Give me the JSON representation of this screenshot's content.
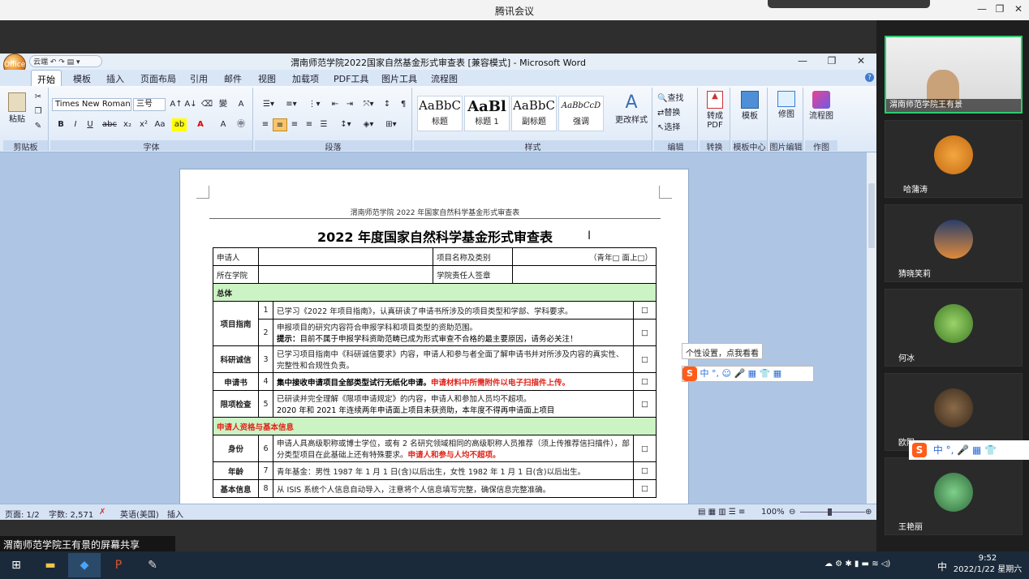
{
  "meeting": {
    "title": "腾讯会议",
    "share_label": "渭南师范学院王有景的屏幕共享",
    "participants": [
      {
        "name": "渭南师范学院王有景",
        "active": true
      },
      {
        "name": "哈蒲涛"
      },
      {
        "name": "猜晓笑莉"
      },
      {
        "name": "何冰"
      },
      {
        "name": "欧阳"
      },
      {
        "name": "王艳丽"
      }
    ]
  },
  "word": {
    "window_title": "渭南师范学院2022国家自然基金形式审查表 [兼容模式] - Microsoft Word",
    "office_button": "Office",
    "qat_label": "云端",
    "tabs": [
      "开始",
      "模板",
      "插入",
      "页面布局",
      "引用",
      "邮件",
      "视图",
      "加载项",
      "PDF工具",
      "图片工具",
      "流程图"
    ],
    "ribbon": {
      "clipboard": {
        "label": "剪贴板",
        "paste": "粘贴"
      },
      "font": {
        "label": "字体",
        "name": "Times New Roman",
        "size": "三号"
      },
      "paragraph": {
        "label": "段落"
      },
      "styles": {
        "label": "样式",
        "items": [
          {
            "sample": "AaBbC",
            "name": "标题"
          },
          {
            "sample": "AaBl",
            "name": "标题 1"
          },
          {
            "sample": "AaBbC",
            "name": "副标题"
          },
          {
            "sample": "AaBbCcD",
            "name": "强调"
          }
        ],
        "change": "更改样式"
      },
      "editing": {
        "label": "编辑",
        "find": "查找",
        "replace": "替换",
        "select": "选择"
      },
      "convert": {
        "label": "转换",
        "btn": "转成 PDF"
      },
      "template": {
        "label": "模板中心",
        "btn": "模板"
      },
      "image": {
        "label": "图片编辑",
        "btn": "修图"
      },
      "works": {
        "label": "作图",
        "btn": "流程图"
      }
    },
    "status": {
      "page": "页面: 1/2",
      "words": "字数: 2,571",
      "lang": "英语(美国)",
      "mode": "插入",
      "zoom": "100%"
    }
  },
  "doc": {
    "header": "渭南师范学院 2022 年国家自然科学基金形式审查表",
    "title": "2022 年度国家自然科学基金形式审查表",
    "applicant_label": "申请人",
    "project_label": "项目名称及类别",
    "project_hint": "（青年□  面上□）",
    "college_label": "所在学院",
    "leader_label": "学院责任人签章",
    "sec_general": "总体",
    "sec_qual": "申请人资格与基本信息",
    "rows": [
      {
        "label": "项目指南",
        "num": "1",
        "text": "已学习《2022 年项目指南》，认真研读了申请书所涉及的项目类型和学部、学科要求。"
      },
      {
        "label": "",
        "num": "2",
        "text": "申报项目的研究内容符合申报学科和项目类型的资助范围。",
        "hint_bold": "提示：",
        "hint": "目前不属于申报学科资助范畴已成为形式审查不合格的最主要原因，请务必关注！"
      },
      {
        "label": "科研诚信",
        "num": "3",
        "text": "已学习项目指南中《科研诚信要求》内容，申请人和参与者全面了解申请书并对所涉及内容的真实性、完整性和合规性负责。"
      },
      {
        "label": "申请书",
        "num": "4",
        "text": "集中接收申请项目全部类型试行无纸化申请。",
        "red": "申请材料中所需附件以电子扫描件上传。"
      },
      {
        "label": "限项检查",
        "num": "5",
        "text": "已研读并完全理解《限项申请规定》的内容，申请人和参加人员均不超项。",
        "text2": "2020 年和 2021 年连续两年申请面上项目未获资助，本年度不得再申请面上项目"
      },
      {
        "label": "身份",
        "num": "6",
        "text": "申请人具高级职称或博士学位，或有 2 名研究领域相同的高级职称人员推荐（须上传推荐信扫描件），部分类型项目在此基础上还有特殊要求。",
        "red": "申请人和参与人均不超项。"
      },
      {
        "label": "年龄",
        "num": "7",
        "text": "青年基金：男性 1987 年 1 月 1 日(含)以后出生，女性 1982 年 1 月 1 日(含)以后出生。"
      },
      {
        "label": "基本信息",
        "num": "8",
        "text": "从 ISIS 系统个人信息自动导入，注意将个人信息填写完整，确保信息完整准确。"
      }
    ]
  },
  "ime": {
    "tooltip": "个性设置，点我看看",
    "bar": "中 °, ☺ 🎤 ▦ 👕 ▦",
    "bar2": "中 °, 🎤 ▦ 👕"
  },
  "taskbar": {
    "time": "9:52",
    "date": "2022/1/22 星期六",
    "ime": "中"
  }
}
